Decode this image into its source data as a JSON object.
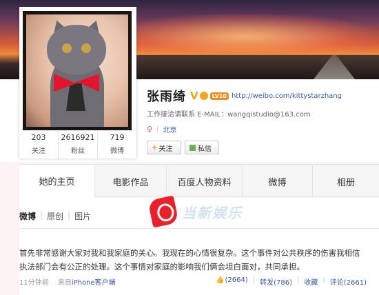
{
  "profile": {
    "name": "张雨绮",
    "v_badge": "V",
    "vip_badge": "LV10",
    "url": "http://weibo.com/kittystarzhang",
    "contact": "工作接洽请联系 E-MAIL：wangqistudio@163.com",
    "location": "北京",
    "gender_icon": "♀"
  },
  "stats": [
    {
      "value": "203",
      "label": "关注"
    },
    {
      "value": "2616921",
      "label": "粉丝"
    },
    {
      "value": "719",
      "label": "微博"
    }
  ],
  "buttons": {
    "follow_plus": "+",
    "follow": "关注",
    "message": "私信"
  },
  "tabs": [
    {
      "label": "她的主页",
      "active": true
    },
    {
      "label": "电影作品"
    },
    {
      "label": "百度人物资料"
    },
    {
      "label": "微博"
    },
    {
      "label": "相册"
    }
  ],
  "subnav": {
    "items": [
      "微博",
      "原创",
      "图片"
    ],
    "separator": "|"
  },
  "watermark": {
    "text": "当新娱乐"
  },
  "post": {
    "text": "首先非常感谢大家对我和我家庭的关心。我现在的心情很复杂。这个事件对公共秩序的伤害我相信执法部门会有公正的处理。这个事情对家庭的影响我们俩会坦白面对，共同承担。",
    "time": "11分钟前",
    "source_prefix": "来自",
    "source": "iPhone客户端",
    "likes": "(2664)",
    "repost": "转发(786)",
    "favorite": "收藏",
    "comment": "评论(2661)",
    "separator": "|"
  },
  "icons": [
    "v-verified-icon",
    "club-icon",
    "gender-female-icon",
    "plus-icon",
    "message-icon",
    "thumb-up-icon"
  ],
  "colors": {
    "link": "#3a5a9a",
    "badge_orange": "#f28a1e",
    "watermark_red": "#e8212b"
  }
}
